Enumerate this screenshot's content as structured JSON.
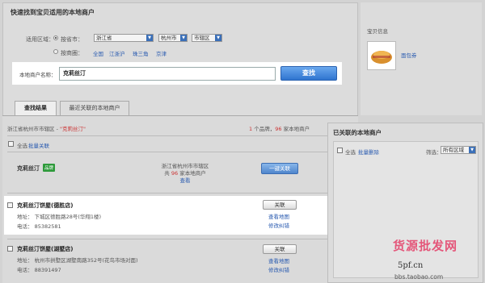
{
  "page": {
    "title": "快速找到宝贝适用的本地商户"
  },
  "filter": {
    "region_label": "适用区域：",
    "option_city": "按省市：",
    "province": "浙江省",
    "city": "杭州市",
    "district": "市辖区",
    "option_circle": "按商圈：",
    "circle_links": [
      "全国",
      "江浙沪",
      "珠三角",
      "京津"
    ]
  },
  "search": {
    "label": "本地商户名称：",
    "value": "克莉丝汀",
    "button": "查找"
  },
  "baby": {
    "title": "宝贝信息",
    "item_label": "面包券"
  },
  "tabs": [
    {
      "label": "查找结果"
    },
    {
      "label": "最近关联的本地商户"
    }
  ],
  "results": {
    "path_prefix": "浙江省杭州市市辖区 - ",
    "keyword": "\"克莉丝汀\"",
    "count_brand": "1",
    "count_brand_suffix": " 个品牌，",
    "count_store": "96",
    "count_store_suffix": " 家本地商户",
    "select_all": "全选",
    "batch_link": "批量关联",
    "brand": {
      "name": "克莉丝汀",
      "badge": "品牌",
      "region": "浙江省杭州市市辖区",
      "total_prefix": "共 ",
      "total": "96",
      "total_suffix": " 家本地商户",
      "view": "查看",
      "button": "一键关联"
    },
    "stores": [
      {
        "name": "克莉丝汀饼屋(德胜店)",
        "address": "地址：  下城区德胜路28号(华翔1楼)",
        "phone": "电话：  85382581",
        "button": "关联",
        "map_link": "查看地图",
        "fix_link": "修改纠错"
      },
      {
        "name": "克莉丝汀饼屋(湖墅店)",
        "address": "地址：  杭州市拱墅区湖墅南路352号(花鸟市场对面)",
        "phone": "电话：  88391497",
        "button": "关联",
        "map_link": "查看地图",
        "fix_link": "修改纠错"
      }
    ]
  },
  "linked": {
    "title": "已关联的本地商户",
    "select_all": "全选",
    "batch_delete": "批量删除",
    "filter_label": "筛选：",
    "filter_value": "所有区域"
  },
  "watermark": {
    "text1": "货源批发网",
    "text2": "5pf.cn",
    "url": "bbs.taobao.com"
  }
}
